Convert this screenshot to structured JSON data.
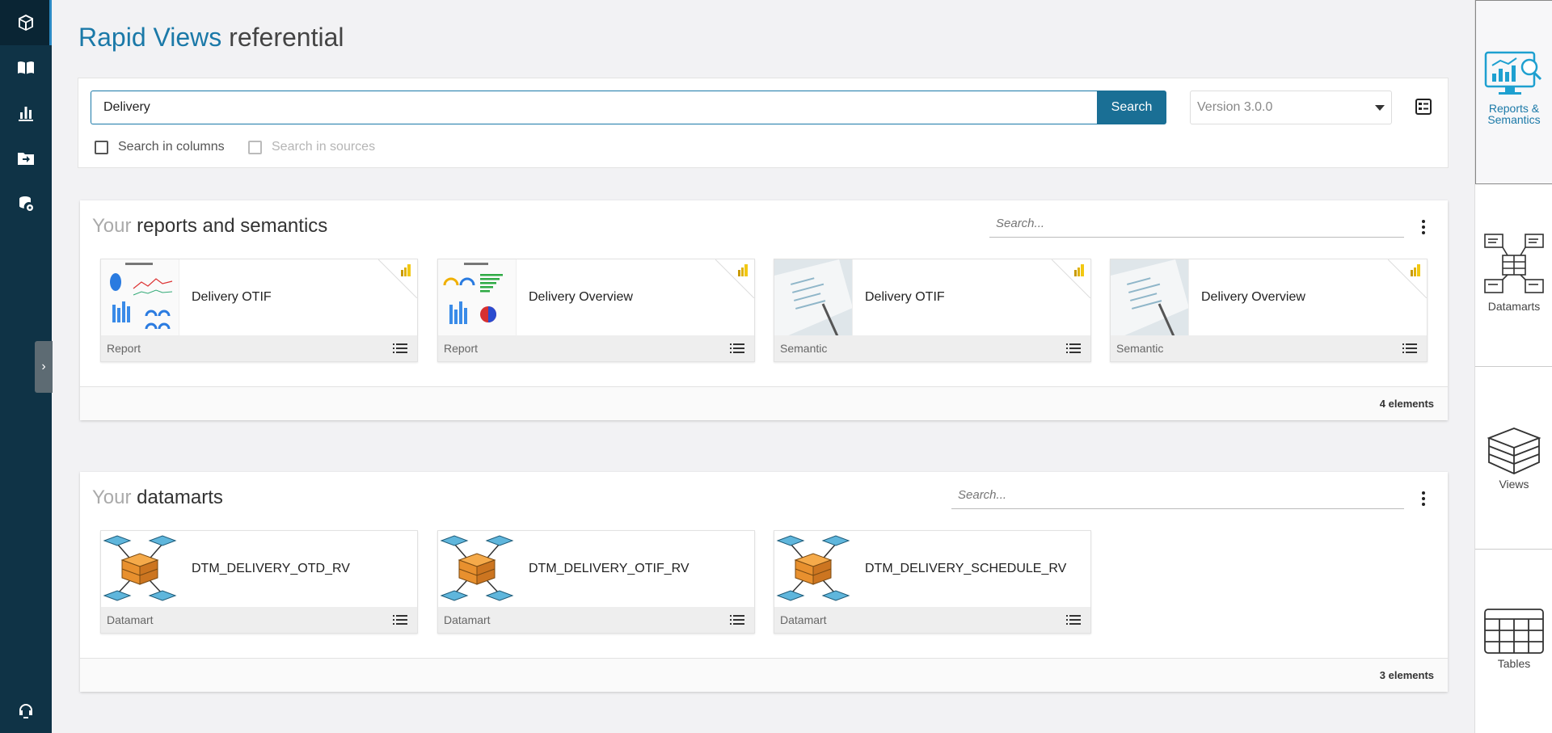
{
  "sidebar": {
    "items": [
      {
        "icon": "cube-icon",
        "active": true
      },
      {
        "icon": "book-icon",
        "active": false
      },
      {
        "icon": "bar-chart-icon",
        "active": false
      },
      {
        "icon": "folder-export-icon",
        "active": false
      },
      {
        "icon": "database-settings-icon",
        "active": false
      }
    ],
    "bottom_icon": "headset-icon",
    "toggle_icon": "chevron-right-icon"
  },
  "header": {
    "title_part1": "Rapid Views",
    "title_part2": "referential"
  },
  "search": {
    "value": "Delivery",
    "button_label": "Search",
    "version_value": "Version 3.0.0",
    "checkbox_columns": "Search in columns",
    "checkbox_sources": "Search in sources"
  },
  "reports_section": {
    "title_light": "Your",
    "title_bold": "reports and semantics",
    "search_placeholder": "Search...",
    "count_label": "4 elements",
    "cards": [
      {
        "name": "Delivery OTIF",
        "type": "Report",
        "thumb": "report-dashboard-thumbnail",
        "badge": "power-bi-icon"
      },
      {
        "name": "Delivery Overview",
        "type": "Report",
        "thumb": "report-dashboard-thumbnail",
        "badge": "power-bi-icon"
      },
      {
        "name": "Delivery OTIF",
        "type": "Semantic",
        "thumb": "semantic-document-thumbnail",
        "badge": "power-bi-icon"
      },
      {
        "name": "Delivery Overview",
        "type": "Semantic",
        "thumb": "semantic-document-thumbnail",
        "badge": "power-bi-icon"
      }
    ]
  },
  "datamarts_section": {
    "title_light": "Your",
    "title_bold": "datamarts",
    "search_placeholder": "Search...",
    "count_label": "3 elements",
    "cards": [
      {
        "name": "DTM_DELIVERY_OTD_RV",
        "type": "Datamart",
        "thumb": "datamart-star-schema-icon"
      },
      {
        "name": "DTM_DELIVERY_OTIF_RV",
        "type": "Datamart",
        "thumb": "datamart-star-schema-icon"
      },
      {
        "name": "DTM_DELIVERY_SCHEDULE_RV",
        "type": "Datamart",
        "thumb": "datamart-star-schema-icon"
      }
    ]
  },
  "right_panel": {
    "items": [
      {
        "label": "Reports & Semantics",
        "icon": "reports-monitor-icon",
        "active": true
      },
      {
        "label": "Datamarts",
        "icon": "datamarts-icon",
        "active": false
      },
      {
        "label": "Views",
        "icon": "views-cube-icon",
        "active": false
      },
      {
        "label": "Tables",
        "icon": "tables-grid-icon",
        "active": false
      }
    ]
  },
  "colors": {
    "sidebar_bg": "#0f3346",
    "accent": "#1b79a8",
    "button": "#1a6f95",
    "power_bi": "#f2c811",
    "datamart_cube": "#e8902e",
    "datamart_node": "#5fb6dc"
  }
}
